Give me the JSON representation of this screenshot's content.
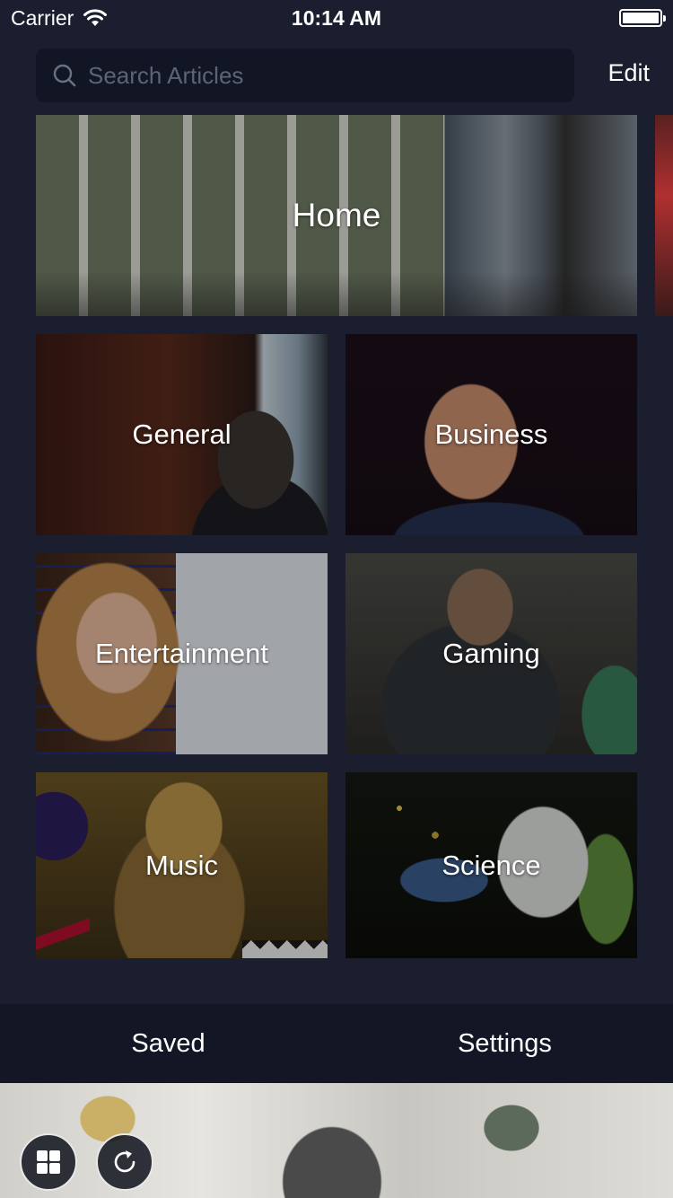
{
  "status_bar": {
    "carrier": "Carrier",
    "time": "10:14 AM",
    "battery_level_percent": 100
  },
  "search": {
    "placeholder": "Search Articles",
    "value": ""
  },
  "header": {
    "edit_label": "Edit"
  },
  "categories": {
    "home": "Home",
    "general": "General",
    "business": "Business",
    "entertainment": "Entertainment",
    "gaming": "Gaming",
    "music": "Music",
    "science": "Science"
  },
  "bottom_bar": {
    "saved_label": "Saved",
    "settings_label": "Settings"
  },
  "icons": {
    "search": "search-icon",
    "wifi": "wifi-icon",
    "battery": "battery-icon",
    "grid": "grid-icon",
    "refresh": "refresh-icon"
  },
  "colors": {
    "background": "#1a1e2e",
    "search_background": "#121624",
    "bottom_bar_background": "#131725",
    "text": "#ffffff",
    "placeholder": "#5d6377"
  }
}
